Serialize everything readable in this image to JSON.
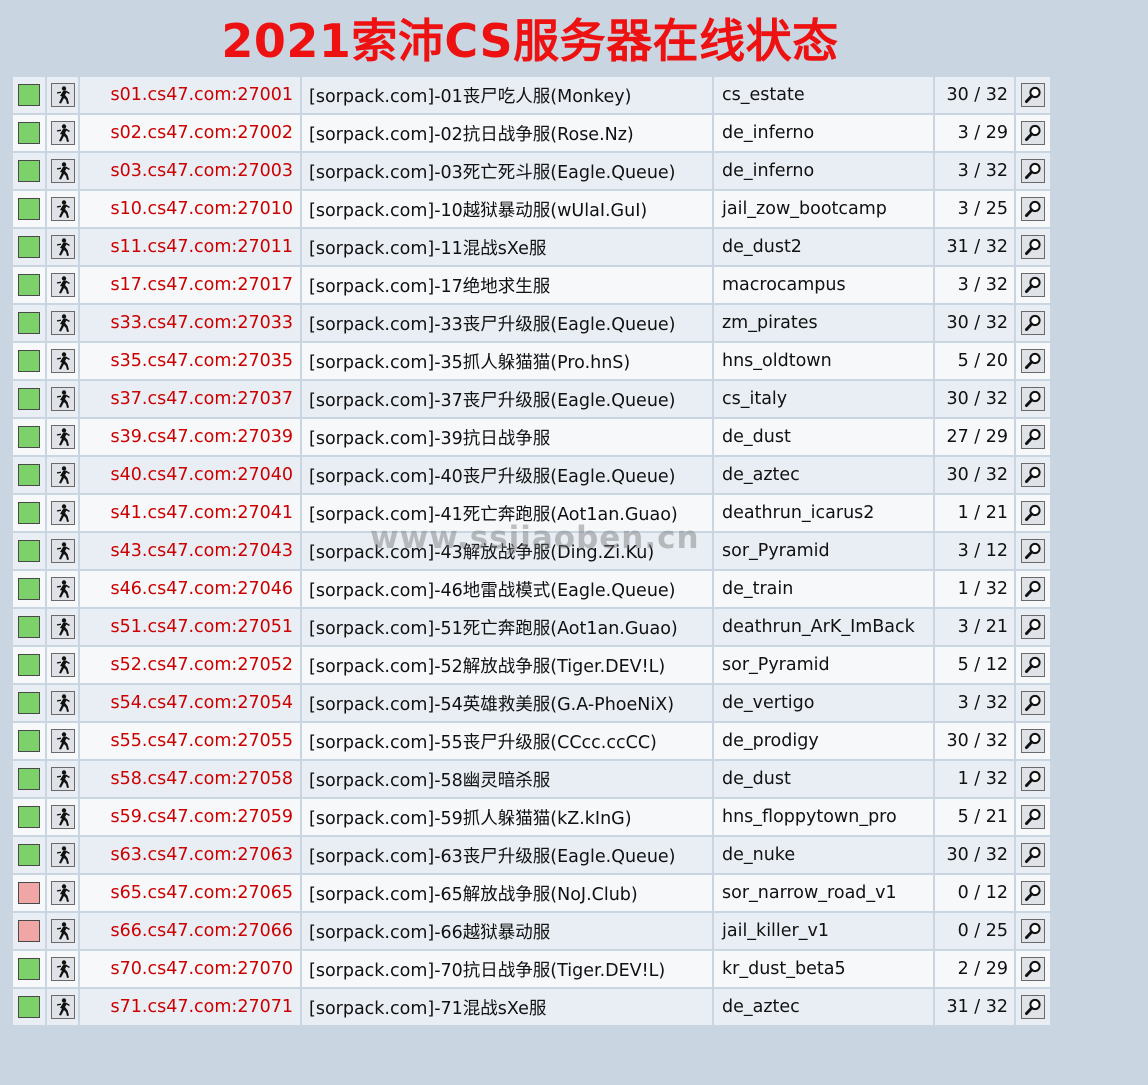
{
  "page": {
    "title": "2021索沛CS服务器在线状态",
    "watermark": "www.ssjiaoben.cn"
  },
  "colors": {
    "title": "#ee1111",
    "address": "#cc0000",
    "online": "#7dd16a",
    "offline": "#f1a6a6",
    "background": "#c9d6e2"
  },
  "icons": {
    "status": "status-square-icon",
    "game": "counter-strike-icon",
    "details": "magnifier-icon"
  },
  "servers": [
    {
      "status": "online",
      "address": "s01.cs47.com:27001",
      "name": "[sorpack.com]-01丧尸吃人服(Monkey)",
      "map": "cs_estate",
      "players": "30 / 32"
    },
    {
      "status": "online",
      "address": "s02.cs47.com:27002",
      "name": "[sorpack.com]-02抗日战争服(Rose.Nz)",
      "map": "de_inferno",
      "players": "3 / 29"
    },
    {
      "status": "online",
      "address": "s03.cs47.com:27003",
      "name": "[sorpack.com]-03死亡死斗服(Eagle.Queue)",
      "map": "de_inferno",
      "players": "3 / 32"
    },
    {
      "status": "online",
      "address": "s10.cs47.com:27010",
      "name": "[sorpack.com]-10越狱暴动服(wUlaI.GuI)",
      "map": "jail_zow_bootcamp",
      "players": "3 / 25"
    },
    {
      "status": "online",
      "address": "s11.cs47.com:27011",
      "name": "[sorpack.com]-11混战sXe服",
      "map": "de_dust2",
      "players": "31 / 32"
    },
    {
      "status": "online",
      "address": "s17.cs47.com:27017",
      "name": "[sorpack.com]-17绝地求生服",
      "map": "macrocampus",
      "players": "3 / 32"
    },
    {
      "status": "online",
      "address": "s33.cs47.com:27033",
      "name": "[sorpack.com]-33丧尸升级服(Eagle.Queue)",
      "map": "zm_pirates",
      "players": "30 / 32"
    },
    {
      "status": "online",
      "address": "s35.cs47.com:27035",
      "name": "[sorpack.com]-35抓人躲猫猫(Pro.hnS)",
      "map": "hns_oldtown",
      "players": "5 / 20"
    },
    {
      "status": "online",
      "address": "s37.cs47.com:27037",
      "name": "[sorpack.com]-37丧尸升级服(Eagle.Queue)",
      "map": "cs_italy",
      "players": "30 / 32"
    },
    {
      "status": "online",
      "address": "s39.cs47.com:27039",
      "name": "[sorpack.com]-39抗日战争服",
      "map": "de_dust",
      "players": "27 / 29"
    },
    {
      "status": "online",
      "address": "s40.cs47.com:27040",
      "name": "[sorpack.com]-40丧尸升级服(Eagle.Queue)",
      "map": "de_aztec",
      "players": "30 / 32"
    },
    {
      "status": "online",
      "address": "s41.cs47.com:27041",
      "name": "[sorpack.com]-41死亡奔跑服(Aot1an.Guao)",
      "map": "deathrun_icarus2",
      "players": "1 / 21"
    },
    {
      "status": "online",
      "address": "s43.cs47.com:27043",
      "name": "[sorpack.com]-43解放战争服(Ding.Zi.Ku)",
      "map": "sor_Pyramid",
      "players": "3 / 12"
    },
    {
      "status": "online",
      "address": "s46.cs47.com:27046",
      "name": "[sorpack.com]-46地雷战模式(Eagle.Queue)",
      "map": "de_train",
      "players": "1 / 32"
    },
    {
      "status": "online",
      "address": "s51.cs47.com:27051",
      "name": "[sorpack.com]-51死亡奔跑服(Aot1an.Guao)",
      "map": "deathrun_ArK_ImBack",
      "players": "3 / 21"
    },
    {
      "status": "online",
      "address": "s52.cs47.com:27052",
      "name": "[sorpack.com]-52解放战争服(Tiger.DEV!L)",
      "map": "sor_Pyramid",
      "players": "5 / 12"
    },
    {
      "status": "online",
      "address": "s54.cs47.com:27054",
      "name": "[sorpack.com]-54英雄救美服(G.A-PhoeNiX)",
      "map": "de_vertigo",
      "players": "3 / 32"
    },
    {
      "status": "online",
      "address": "s55.cs47.com:27055",
      "name": "[sorpack.com]-55丧尸升级服(CCcc.ccCC)",
      "map": "de_prodigy",
      "players": "30 / 32"
    },
    {
      "status": "online",
      "address": "s58.cs47.com:27058",
      "name": "[sorpack.com]-58幽灵暗杀服",
      "map": "de_dust",
      "players": "1 / 32"
    },
    {
      "status": "online",
      "address": "s59.cs47.com:27059",
      "name": "[sorpack.com]-59抓人躲猫猫(kZ.kInG)",
      "map": "hns_floppytown_pro",
      "players": "5 / 21"
    },
    {
      "status": "online",
      "address": "s63.cs47.com:27063",
      "name": "[sorpack.com]-63丧尸升级服(Eagle.Queue)",
      "map": "de_nuke",
      "players": "30 / 32"
    },
    {
      "status": "offline",
      "address": "s65.cs47.com:27065",
      "name": "[sorpack.com]-65解放战争服(NoJ.Club)",
      "map": "sor_narrow_road_v1",
      "players": "0 / 12"
    },
    {
      "status": "offline",
      "address": "s66.cs47.com:27066",
      "name": "[sorpack.com]-66越狱暴动服",
      "map": "jail_killer_v1",
      "players": "0 / 25"
    },
    {
      "status": "online",
      "address": "s70.cs47.com:27070",
      "name": "[sorpack.com]-70抗日战争服(Tiger.DEV!L)",
      "map": "kr_dust_beta5",
      "players": "2 / 29"
    },
    {
      "status": "online",
      "address": "s71.cs47.com:27071",
      "name": "[sorpack.com]-71混战sXe服",
      "map": "de_aztec",
      "players": "31 / 32"
    }
  ]
}
